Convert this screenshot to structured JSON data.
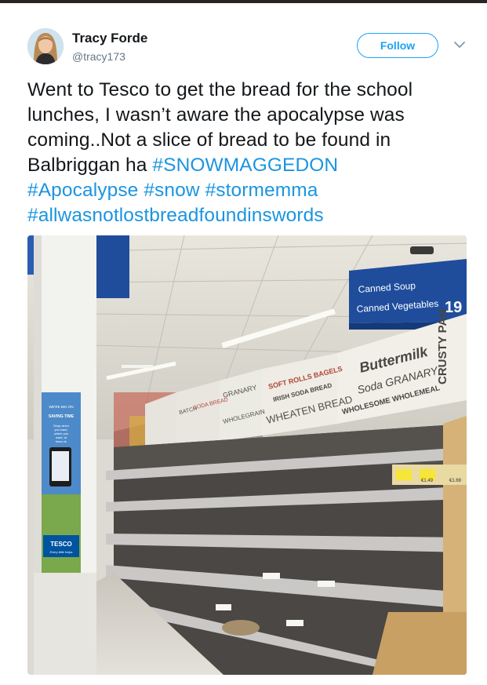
{
  "tweet": {
    "author_name": "Tracy Forde",
    "author_handle": "@tracy173",
    "follow_label": "Follow",
    "text_line_1": "Went to Tesco to get the bread for the school",
    "text_line_2": "lunches, I wasn’t aware the apocalypse was",
    "text_line_3": "coming..Not a slice of bread to be found in",
    "text_line_4_plain": "Balbriggan ha ",
    "hashtags": [
      "#SNOWMAGGEDON",
      "#Apocalypse",
      "#snow",
      "#stormemma",
      "#allwasnotlostbreadfoundinswords"
    ]
  },
  "photo": {
    "aisle_sign_lines": [
      "Canned Soup",
      "Canned Vegetables"
    ],
    "aisle_number": "19",
    "shelf_labels": [
      "Buttermilk",
      "Soda GRANARY",
      "WHOLESOME WHOLEMEAL",
      "CRUSTY PAN",
      "SOFT ROLLS BAGELS",
      "IRISH SODA BREAD",
      "WHEATEN BREAD",
      "GRANARY",
      "WHOLEGRAIN",
      "BATCH",
      "SODA BREAD"
    ],
    "pillar_poster_lines": [
      "WE'RE BIG ON",
      "SAVING TIME",
      "Shop when",
      "you want,",
      "where you",
      "want, at",
      "tesco.ie",
      "TESCO",
      "Every little helps"
    ],
    "price_tags": [
      "€1.49",
      "€1.69"
    ]
  },
  "icons": [
    "caret-down-icon",
    "avatar"
  ],
  "colors": {
    "accent": "#1da1f2",
    "hashtag": "#1b95e0",
    "aisle_sign": "#1f4d9c",
    "tesco_blue": "#00539f"
  }
}
